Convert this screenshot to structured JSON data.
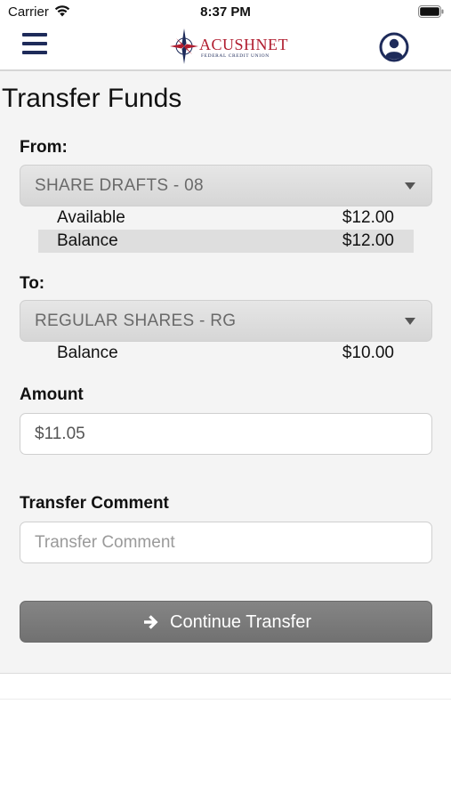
{
  "status_bar": {
    "carrier": "Carrier",
    "time": "8:37 PM"
  },
  "header": {
    "logo_text": "ACUSHNET",
    "logo_subtext": "FEDERAL CREDIT UNION",
    "brand_colors": {
      "red": "#b01c2e",
      "navy": "#1e2b5a"
    },
    "menu_icon": "hamburger-menu-icon",
    "profile_icon": "user-profile-icon"
  },
  "page": {
    "title": "Transfer Funds"
  },
  "from": {
    "label": "From:",
    "selected": "SHARE DRAFTS - 08",
    "rows": [
      {
        "label": "Available",
        "value": "$12.00"
      },
      {
        "label": "Balance",
        "value": "$12.00"
      }
    ]
  },
  "to": {
    "label": "To:",
    "selected": "REGULAR SHARES - RG",
    "rows": [
      {
        "label": "Balance",
        "value": "$10.00"
      }
    ]
  },
  "amount": {
    "label": "Amount",
    "value": "$11.05"
  },
  "comment": {
    "label": "Transfer Comment",
    "placeholder": "Transfer Comment",
    "value": ""
  },
  "actions": {
    "continue_label": "Continue Transfer",
    "continue_icon": "arrow-right-icon"
  }
}
